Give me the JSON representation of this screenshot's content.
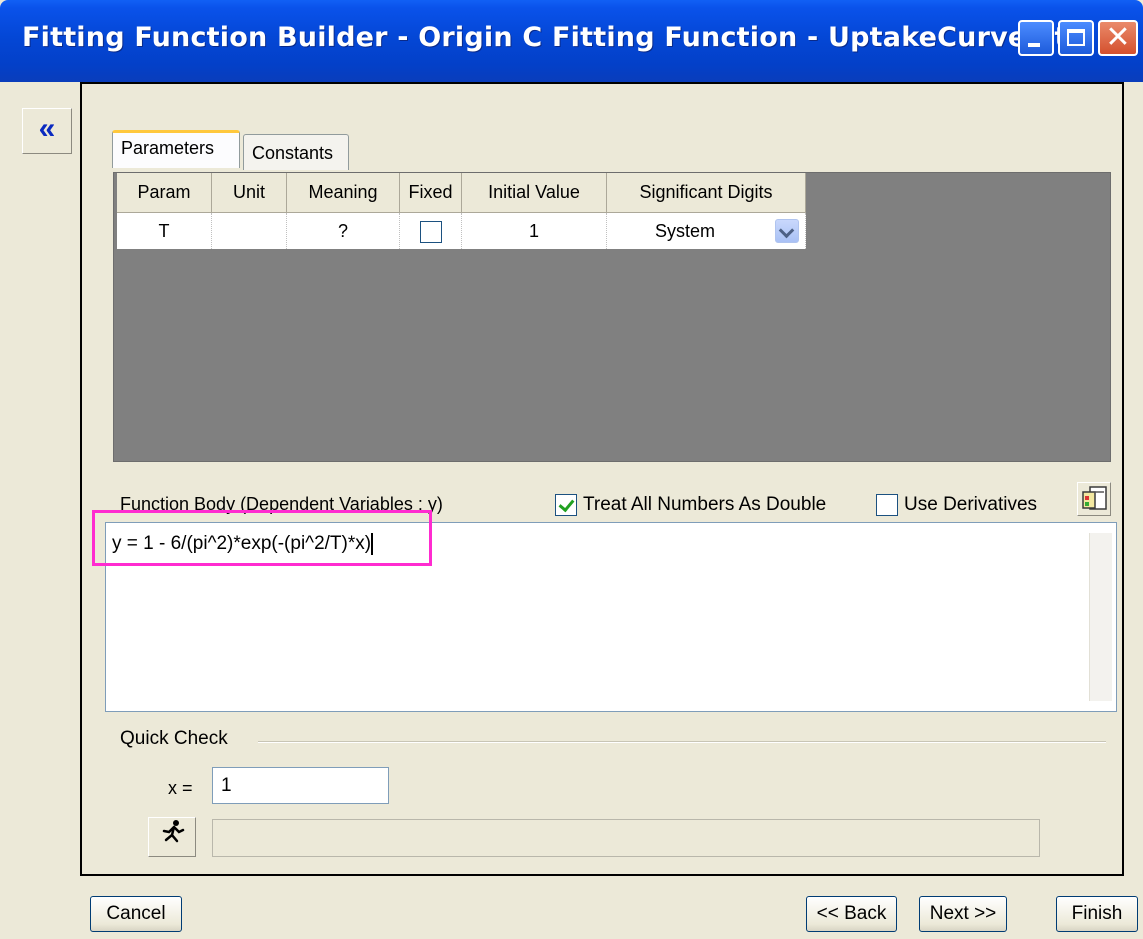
{
  "window": {
    "title": "Fitting Function Builder - Origin C Fitting Function - UptakeCurveFit",
    "minimize_icon": "minimize-icon",
    "maximize_icon": "maximize-icon",
    "close_icon": "close-icon"
  },
  "collapse": {
    "glyph": "«"
  },
  "tabs": [
    {
      "label": "Parameters",
      "active": true
    },
    {
      "label": "Constants",
      "active": false
    }
  ],
  "param_table": {
    "headers": [
      "Param",
      "Unit",
      "Meaning",
      "Fixed",
      "Initial Value",
      "Significant Digits"
    ],
    "rows": [
      {
        "param": "T",
        "unit": "",
        "meaning": "?",
        "fixed": false,
        "initial_value": "1",
        "significant_digits": "System"
      }
    ]
  },
  "function_body": {
    "label": "Function Body (Dependent Variables : y)",
    "treat_double_label": "Treat All Numbers As Double",
    "treat_double_checked": true,
    "use_derivatives_label": "Use Derivatives",
    "use_derivatives_checked": false,
    "code": "y = 1 - 6/(pi^2)*exp(-(pi^2/T)*x)"
  },
  "quick_check": {
    "label": "Quick Check",
    "x_label": "x =",
    "x_value": "1",
    "result": ""
  },
  "buttons": {
    "cancel": "Cancel",
    "back": "<< Back",
    "next": "Next >>",
    "finish": "Finish"
  },
  "colors": {
    "titlebar": "#0447d6",
    "highlight": "#ff2bd0",
    "tab_accent": "#ffc83c"
  }
}
